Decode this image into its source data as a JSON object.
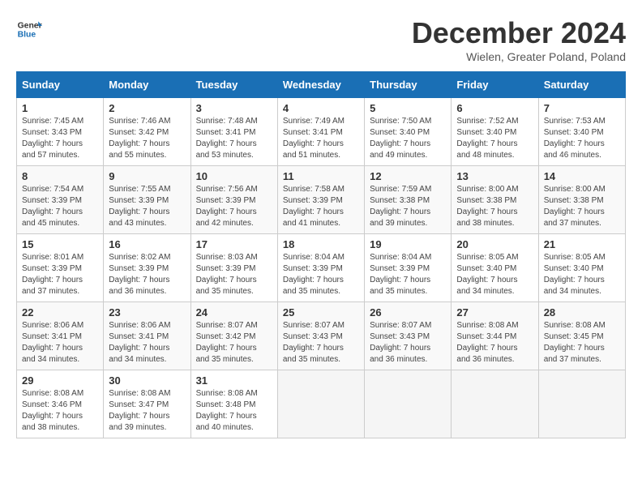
{
  "logo": {
    "text_general": "General",
    "text_blue": "Blue"
  },
  "title": "December 2024",
  "subtitle": "Wielen, Greater Poland, Poland",
  "days_of_week": [
    "Sunday",
    "Monday",
    "Tuesday",
    "Wednesday",
    "Thursday",
    "Friday",
    "Saturday"
  ],
  "weeks": [
    [
      {
        "day": "1",
        "sunrise": "7:45 AM",
        "sunset": "3:43 PM",
        "daylight": "7 hours and 57 minutes."
      },
      {
        "day": "2",
        "sunrise": "7:46 AM",
        "sunset": "3:42 PM",
        "daylight": "7 hours and 55 minutes."
      },
      {
        "day": "3",
        "sunrise": "7:48 AM",
        "sunset": "3:41 PM",
        "daylight": "7 hours and 53 minutes."
      },
      {
        "day": "4",
        "sunrise": "7:49 AM",
        "sunset": "3:41 PM",
        "daylight": "7 hours and 51 minutes."
      },
      {
        "day": "5",
        "sunrise": "7:50 AM",
        "sunset": "3:40 PM",
        "daylight": "7 hours and 49 minutes."
      },
      {
        "day": "6",
        "sunrise": "7:52 AM",
        "sunset": "3:40 PM",
        "daylight": "7 hours and 48 minutes."
      },
      {
        "day": "7",
        "sunrise": "7:53 AM",
        "sunset": "3:40 PM",
        "daylight": "7 hours and 46 minutes."
      }
    ],
    [
      {
        "day": "8",
        "sunrise": "7:54 AM",
        "sunset": "3:39 PM",
        "daylight": "7 hours and 45 minutes."
      },
      {
        "day": "9",
        "sunrise": "7:55 AM",
        "sunset": "3:39 PM",
        "daylight": "7 hours and 43 minutes."
      },
      {
        "day": "10",
        "sunrise": "7:56 AM",
        "sunset": "3:39 PM",
        "daylight": "7 hours and 42 minutes."
      },
      {
        "day": "11",
        "sunrise": "7:58 AM",
        "sunset": "3:39 PM",
        "daylight": "7 hours and 41 minutes."
      },
      {
        "day": "12",
        "sunrise": "7:59 AM",
        "sunset": "3:38 PM",
        "daylight": "7 hours and 39 minutes."
      },
      {
        "day": "13",
        "sunrise": "8:00 AM",
        "sunset": "3:38 PM",
        "daylight": "7 hours and 38 minutes."
      },
      {
        "day": "14",
        "sunrise": "8:00 AM",
        "sunset": "3:38 PM",
        "daylight": "7 hours and 37 minutes."
      }
    ],
    [
      {
        "day": "15",
        "sunrise": "8:01 AM",
        "sunset": "3:39 PM",
        "daylight": "7 hours and 37 minutes."
      },
      {
        "day": "16",
        "sunrise": "8:02 AM",
        "sunset": "3:39 PM",
        "daylight": "7 hours and 36 minutes."
      },
      {
        "day": "17",
        "sunrise": "8:03 AM",
        "sunset": "3:39 PM",
        "daylight": "7 hours and 35 minutes."
      },
      {
        "day": "18",
        "sunrise": "8:04 AM",
        "sunset": "3:39 PM",
        "daylight": "7 hours and 35 minutes."
      },
      {
        "day": "19",
        "sunrise": "8:04 AM",
        "sunset": "3:39 PM",
        "daylight": "7 hours and 35 minutes."
      },
      {
        "day": "20",
        "sunrise": "8:05 AM",
        "sunset": "3:40 PM",
        "daylight": "7 hours and 34 minutes."
      },
      {
        "day": "21",
        "sunrise": "8:05 AM",
        "sunset": "3:40 PM",
        "daylight": "7 hours and 34 minutes."
      }
    ],
    [
      {
        "day": "22",
        "sunrise": "8:06 AM",
        "sunset": "3:41 PM",
        "daylight": "7 hours and 34 minutes."
      },
      {
        "day": "23",
        "sunrise": "8:06 AM",
        "sunset": "3:41 PM",
        "daylight": "7 hours and 34 minutes."
      },
      {
        "day": "24",
        "sunrise": "8:07 AM",
        "sunset": "3:42 PM",
        "daylight": "7 hours and 35 minutes."
      },
      {
        "day": "25",
        "sunrise": "8:07 AM",
        "sunset": "3:43 PM",
        "daylight": "7 hours and 35 minutes."
      },
      {
        "day": "26",
        "sunrise": "8:07 AM",
        "sunset": "3:43 PM",
        "daylight": "7 hours and 36 minutes."
      },
      {
        "day": "27",
        "sunrise": "8:08 AM",
        "sunset": "3:44 PM",
        "daylight": "7 hours and 36 minutes."
      },
      {
        "day": "28",
        "sunrise": "8:08 AM",
        "sunset": "3:45 PM",
        "daylight": "7 hours and 37 minutes."
      }
    ],
    [
      {
        "day": "29",
        "sunrise": "8:08 AM",
        "sunset": "3:46 PM",
        "daylight": "7 hours and 38 minutes."
      },
      {
        "day": "30",
        "sunrise": "8:08 AM",
        "sunset": "3:47 PM",
        "daylight": "7 hours and 39 minutes."
      },
      {
        "day": "31",
        "sunrise": "8:08 AM",
        "sunset": "3:48 PM",
        "daylight": "7 hours and 40 minutes."
      },
      null,
      null,
      null,
      null
    ]
  ]
}
